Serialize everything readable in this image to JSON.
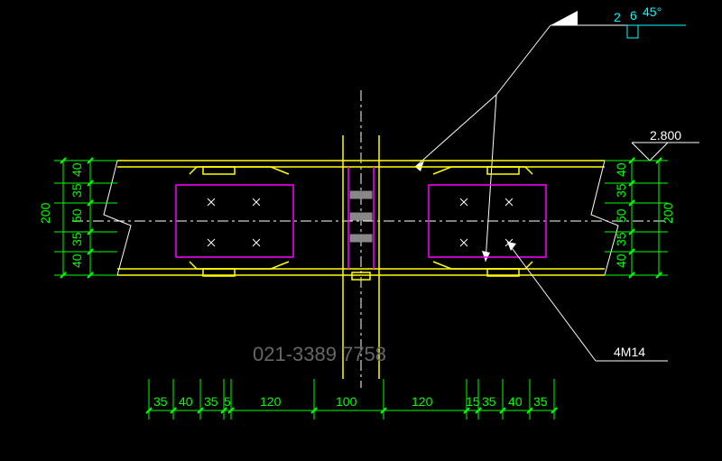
{
  "weld": {
    "size1": "2",
    "size2": "6",
    "angle": "45°"
  },
  "elevation": "2.800",
  "annotation": "4M14",
  "phone": "021-3389 7758",
  "dims_left_vertical": {
    "total": "200",
    "segs": [
      "40",
      "35",
      "50",
      "35",
      "40"
    ]
  },
  "dims_right_vertical": {
    "total": "200",
    "segs": [
      "40",
      "35",
      "50",
      "35",
      "40"
    ]
  },
  "dims_bottom": [
    "35",
    "40",
    "35",
    "5",
    "120",
    "100",
    "120",
    "15",
    "35",
    "40",
    "35"
  ]
}
